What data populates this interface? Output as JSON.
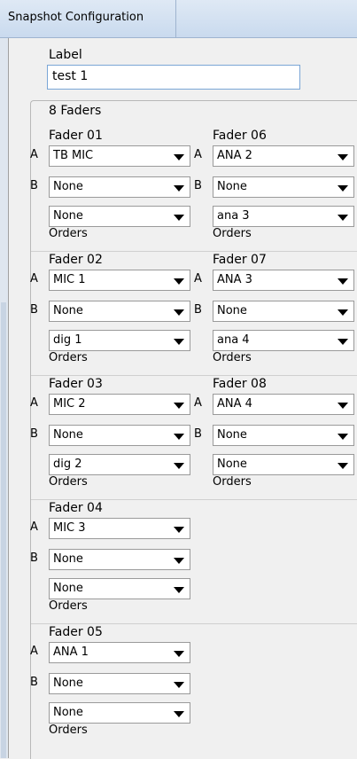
{
  "window": {
    "title": "Snapshot Configuration"
  },
  "label": {
    "caption": "Label",
    "value": "test 1"
  },
  "faders_title": "8 Faders",
  "faders": [
    {
      "name": "Fader 01",
      "a_tag": "A",
      "b_tag": "B",
      "a": "TB MIC",
      "b": "None",
      "c": "None",
      "orders": "Orders"
    },
    {
      "name": "Fader 06",
      "a_tag": "A",
      "b_tag": "B",
      "a": "ANA 2",
      "b": "None",
      "c": "ana 3",
      "orders": "Orders"
    },
    {
      "name": "Fader 02",
      "a_tag": "A",
      "b_tag": "B",
      "a": "MIC 1",
      "b": "None",
      "c": "dig 1",
      "orders": "Orders"
    },
    {
      "name": "Fader 07",
      "a_tag": "A",
      "b_tag": "B",
      "a": "ANA 3",
      "b": "None",
      "c": "ana 4",
      "orders": "Orders"
    },
    {
      "name": "Fader 03",
      "a_tag": "A",
      "b_tag": "B",
      "a": "MIC 2",
      "b": "None",
      "c": "dig 2",
      "orders": "Orders"
    },
    {
      "name": "Fader 08",
      "a_tag": "A",
      "b_tag": "B",
      "a": "ANA 4",
      "b": "None",
      "c": "None",
      "orders": "Orders"
    },
    {
      "name": "Fader 04",
      "a_tag": "A",
      "b_tag": "B",
      "a": "MIC 3",
      "b": "None",
      "c": "None",
      "orders": "Orders"
    },
    {
      "name": "Fader 05",
      "a_tag": "A",
      "b_tag": "B",
      "a": "ANA 1",
      "b": "None",
      "c": "None",
      "orders": "Orders"
    }
  ]
}
